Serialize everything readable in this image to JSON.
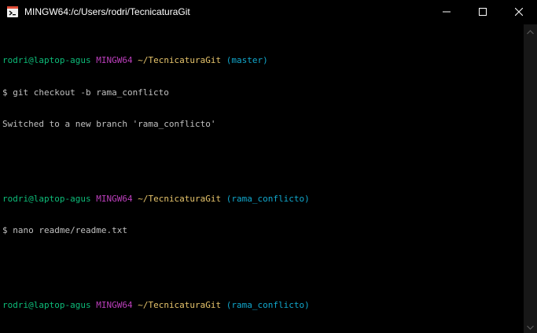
{
  "window": {
    "title": "MINGW64:/c/Users/rodri/TecnicaturaGit",
    "icon": "git-bash-icon",
    "controls": [
      "minimize-icon",
      "maximize-icon",
      "close-icon"
    ]
  },
  "colors": {
    "background": "#000000",
    "user_host": "#0dbc79",
    "system": "#bc3fbc",
    "path": "#e5c36b",
    "branch": "#11a8cd",
    "text": "#c0c0c0"
  },
  "terminal": {
    "blocks": [
      {
        "user_host": "rodri@laptop-agus",
        "system": "MINGW64",
        "path": "~/TecnicaturaGit",
        "branch": "(master)",
        "command": "$ git checkout -b rama_conflicto",
        "output": "Switched to a new branch 'rama_conflicto'"
      },
      {
        "user_host": "rodri@laptop-agus",
        "system": "MINGW64",
        "path": "~/TecnicaturaGit",
        "branch": "(rama_conflicto)",
        "command": "$ nano readme/readme.txt"
      },
      {
        "user_host": "rodri@laptop-agus",
        "system": "MINGW64",
        "path": "~/TecnicaturaGit",
        "branch": "(rama_conflicto)",
        "command": "$"
      }
    ]
  }
}
